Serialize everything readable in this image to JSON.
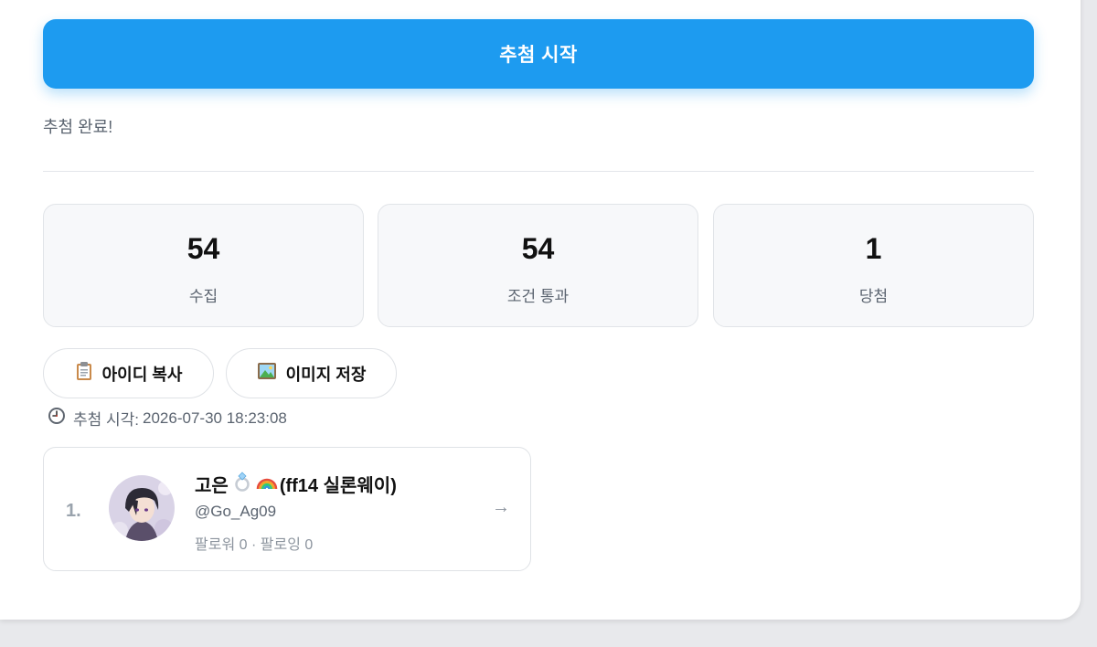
{
  "actions": {
    "start_label": "추첨 시작",
    "copy_ids_label": "아이디 복사",
    "save_image_label": "이미지 저장"
  },
  "status_text": "추첨 완료!",
  "stats": [
    {
      "value": "54",
      "label": "수집"
    },
    {
      "value": "54",
      "label": "조건 통과"
    },
    {
      "value": "1",
      "label": "당첨"
    }
  ],
  "timestamp": {
    "icon": "clock-icon",
    "label": "추첨 시각:",
    "value": "2026-07-30 18:23:08"
  },
  "winners": [
    {
      "rank": "1.",
      "display_name": "고은",
      "name_suffix": "(ff14 실론웨이)",
      "name_emojis": [
        "ring-icon",
        "rainbow-icon"
      ],
      "handle": "@Go_Ag09",
      "followers_label": "팔로워",
      "followers": "0",
      "separator": "·",
      "following_label": "팔로잉",
      "following": "0",
      "arrow": "→"
    }
  ],
  "colors": {
    "primary": "#1d9bf0",
    "muted_text": "#5b6470",
    "card_bg": "#f7f8fa",
    "border": "#e1e4e8"
  }
}
